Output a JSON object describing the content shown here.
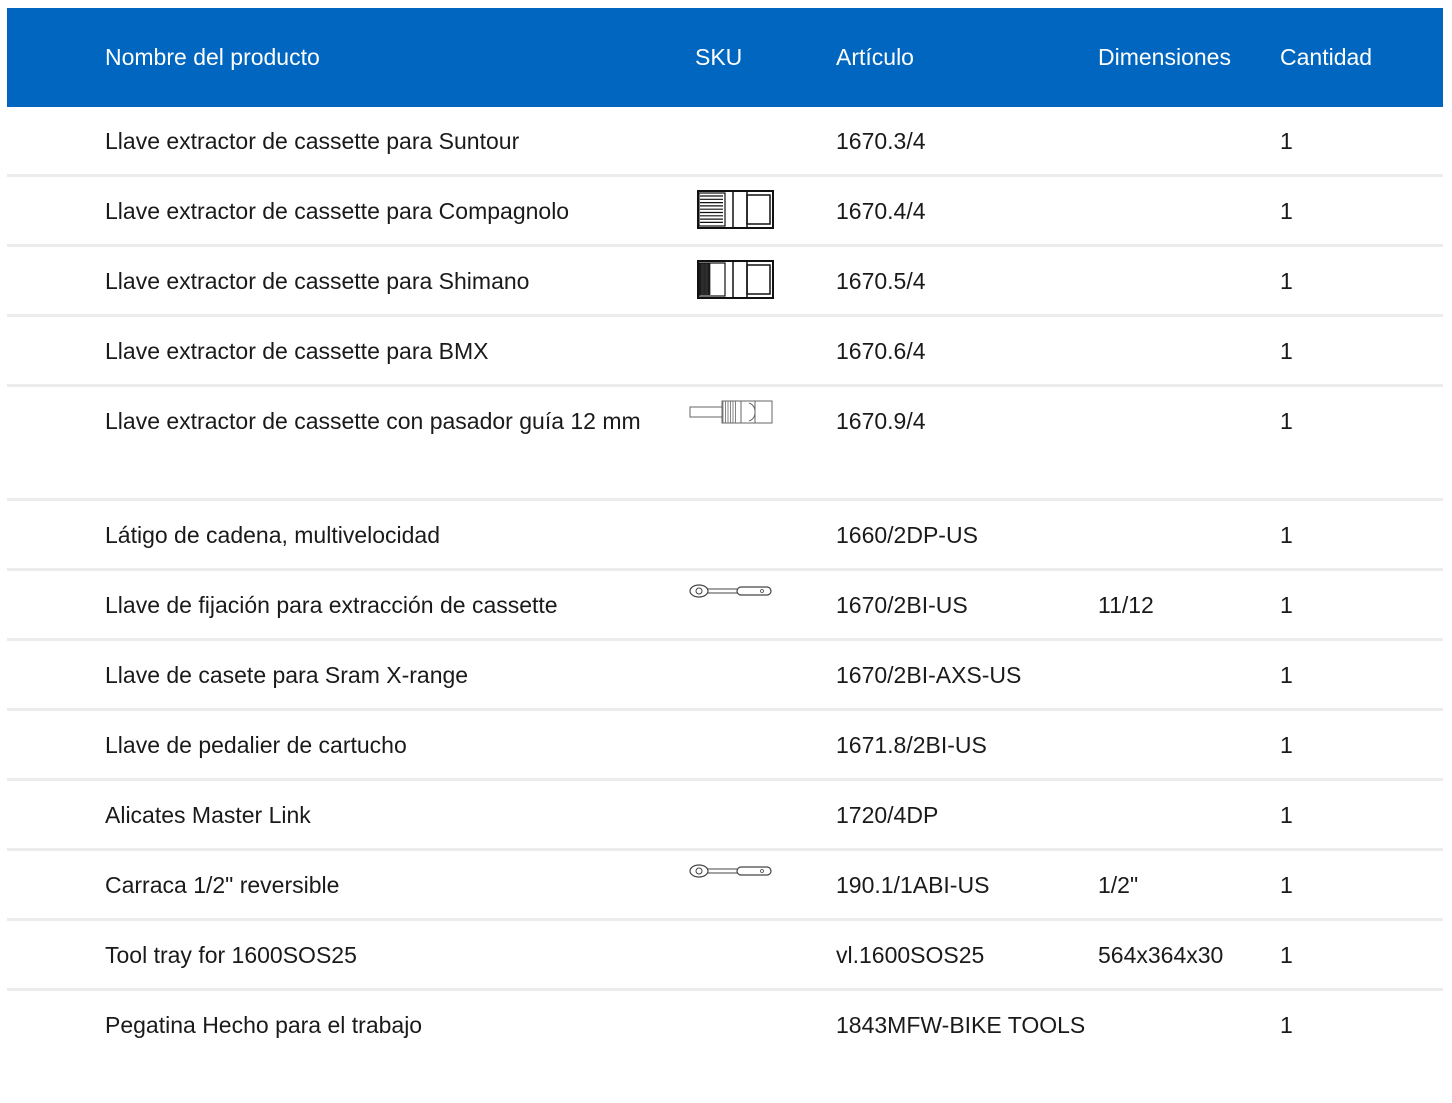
{
  "header": {
    "name": "Nombre del producto",
    "sku": "SKU",
    "article": "Artículo",
    "dimensions": "Dimensiones",
    "quantity": "Cantidad"
  },
  "rows": [
    {
      "name": "Llave extractor de cassette para Suntour",
      "article": "1670.3/4",
      "dimensions": "",
      "quantity": "1",
      "icon": ""
    },
    {
      "name": "Llave extractor de cassette para Compagnolo",
      "article": "1670.4/4",
      "dimensions": "",
      "quantity": "1",
      "icon": "cassette-tool-icon"
    },
    {
      "name": "Llave extractor de cassette para Shimano",
      "article": "1670.5/4",
      "dimensions": "",
      "quantity": "1",
      "icon": "cassette-tool-icon"
    },
    {
      "name": "Llave extractor de cassette para BMX",
      "article": "1670.6/4",
      "dimensions": "",
      "quantity": "1",
      "icon": ""
    },
    {
      "name": "Llave extractor de cassette con pasador guía 12 mm",
      "article": "1670.9/4",
      "dimensions": "",
      "quantity": "1",
      "icon": "cassette-pin-tool-icon"
    },
    {
      "name": "Látigo de cadena, multivelocidad",
      "article": "1660/2DP-US",
      "dimensions": "",
      "quantity": "1",
      "icon": ""
    },
    {
      "name": "Llave de fijación para extracción de cassette",
      "article": "1670/2BI-US",
      "dimensions": "11/12",
      "quantity": "1",
      "icon": "ratchet-icon"
    },
    {
      "name": "Llave de casete para Sram X-range",
      "article": "1670/2BI-AXS-US",
      "dimensions": "",
      "quantity": "1",
      "icon": ""
    },
    {
      "name": "Llave de pedalier de cartucho",
      "article": "1671.8/2BI-US",
      "dimensions": "",
      "quantity": "1",
      "icon": ""
    },
    {
      "name": "Alicates Master Link",
      "article": "1720/4DP",
      "dimensions": "",
      "quantity": "1",
      "icon": ""
    },
    {
      "name": "Carraca 1/2\" reversible",
      "article": "190.1/1ABI-US",
      "dimensions": "1/2\"",
      "quantity": "1",
      "icon": "ratchet-icon"
    },
    {
      "name": "Tool tray for 1600SOS25",
      "article": "vl.1600SOS25",
      "dimensions": "564x364x30",
      "quantity": "1",
      "icon": ""
    },
    {
      "name": "Pegatina Hecho para el trabajo",
      "article": "1843MFW-BIKE TOOLS",
      "dimensions": "",
      "quantity": "1",
      "icon": ""
    }
  ],
  "colors": {
    "header_bg": "#0066bf",
    "header_text": "#ffffff",
    "row_divider": "#ececec"
  }
}
